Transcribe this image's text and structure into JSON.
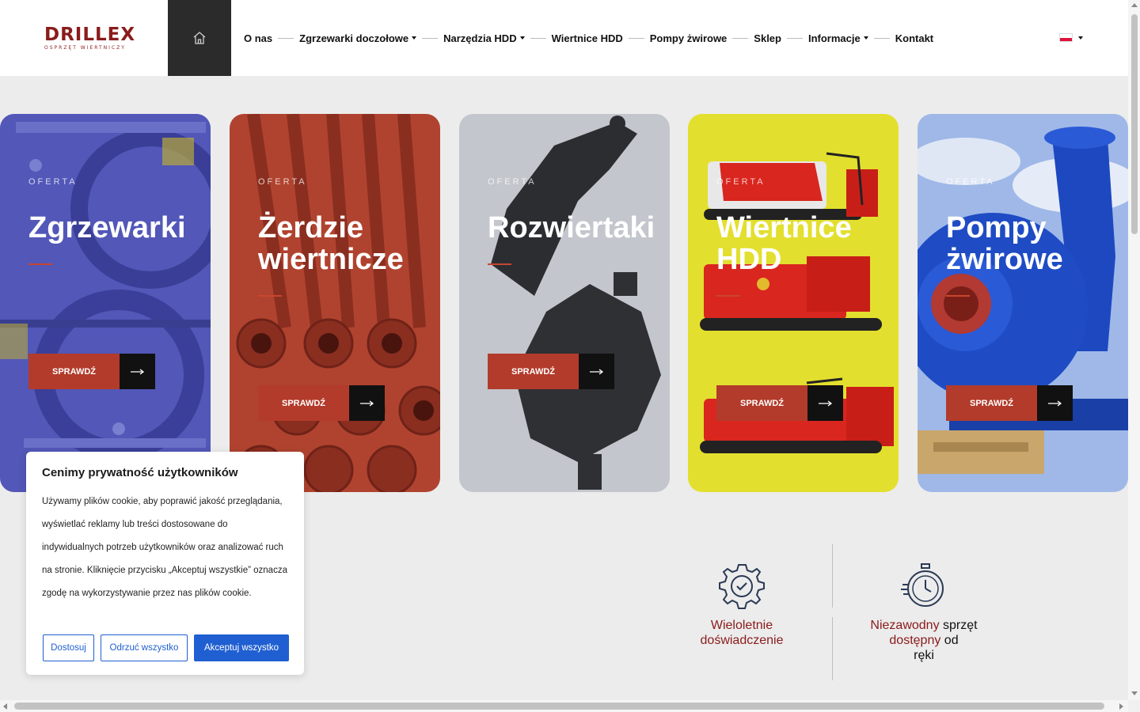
{
  "logo": {
    "main": "DRILLEX",
    "sub": "OSPRZĘT WIERTNICZY"
  },
  "nav": {
    "items": [
      {
        "label": "O nas",
        "dropdown": false
      },
      {
        "label": "Zgrzewarki doczołowe",
        "dropdown": true
      },
      {
        "label": "Narzędzia HDD",
        "dropdown": true
      },
      {
        "label": "Wiertnice HDD",
        "dropdown": false
      },
      {
        "label": "Pompy żwirowe",
        "dropdown": false
      },
      {
        "label": "Sklep",
        "dropdown": false
      },
      {
        "label": "Informacje",
        "dropdown": true
      },
      {
        "label": "Kontakt",
        "dropdown": false
      }
    ]
  },
  "cards": [
    {
      "label": "OFERTA",
      "title": "Zgrzewarki",
      "button": "SPRAWDŹ"
    },
    {
      "label": "OFERTA",
      "title": "Żerdzie wiertnicze",
      "button": "SPRAWDŹ"
    },
    {
      "label": "OFERTA",
      "title": "Rozwiertaki",
      "button": "SPRAWDŹ"
    },
    {
      "label": "OFERTA",
      "title": "Wiertnice HDD",
      "button": "SPRAWDŹ"
    },
    {
      "label": "OFERTA",
      "title": "Pompy żwirowe",
      "button": "SPRAWDŹ"
    }
  ],
  "features": [
    {
      "red1": "Wieloletnie",
      "red2": "doświadczenie"
    },
    {
      "red1": "Niezawodny",
      "dark1": " sprzęt",
      "red2": "dostępny",
      "dark2": " od",
      "dark3": "ręki"
    }
  ],
  "cookie": {
    "title": "Cenimy prywatność użytkowników",
    "text": "Używamy plików cookie, aby poprawić jakość przeglądania, wyświetlać reklamy lub treści dostosowane do indywidualnych potrzeb użytkowników oraz analizować ruch na stronie. Kliknięcie przycisku „Akceptuj wszystkie” oznacza zgodę na wykorzystywanie przez nas plików cookie.",
    "customize": "Dostosuj",
    "reject": "Odrzuć wszystko",
    "accept": "Akceptuj wszystko"
  },
  "colors": {
    "brand": "#8b1c1c",
    "button_red": "#b33b2b",
    "accept_blue": "#1f5fd1",
    "card_bg": [
      "#4a4fb0",
      "#b0432f",
      "#b9bcc4",
      "#e3df2e",
      "#2a57c9"
    ]
  }
}
